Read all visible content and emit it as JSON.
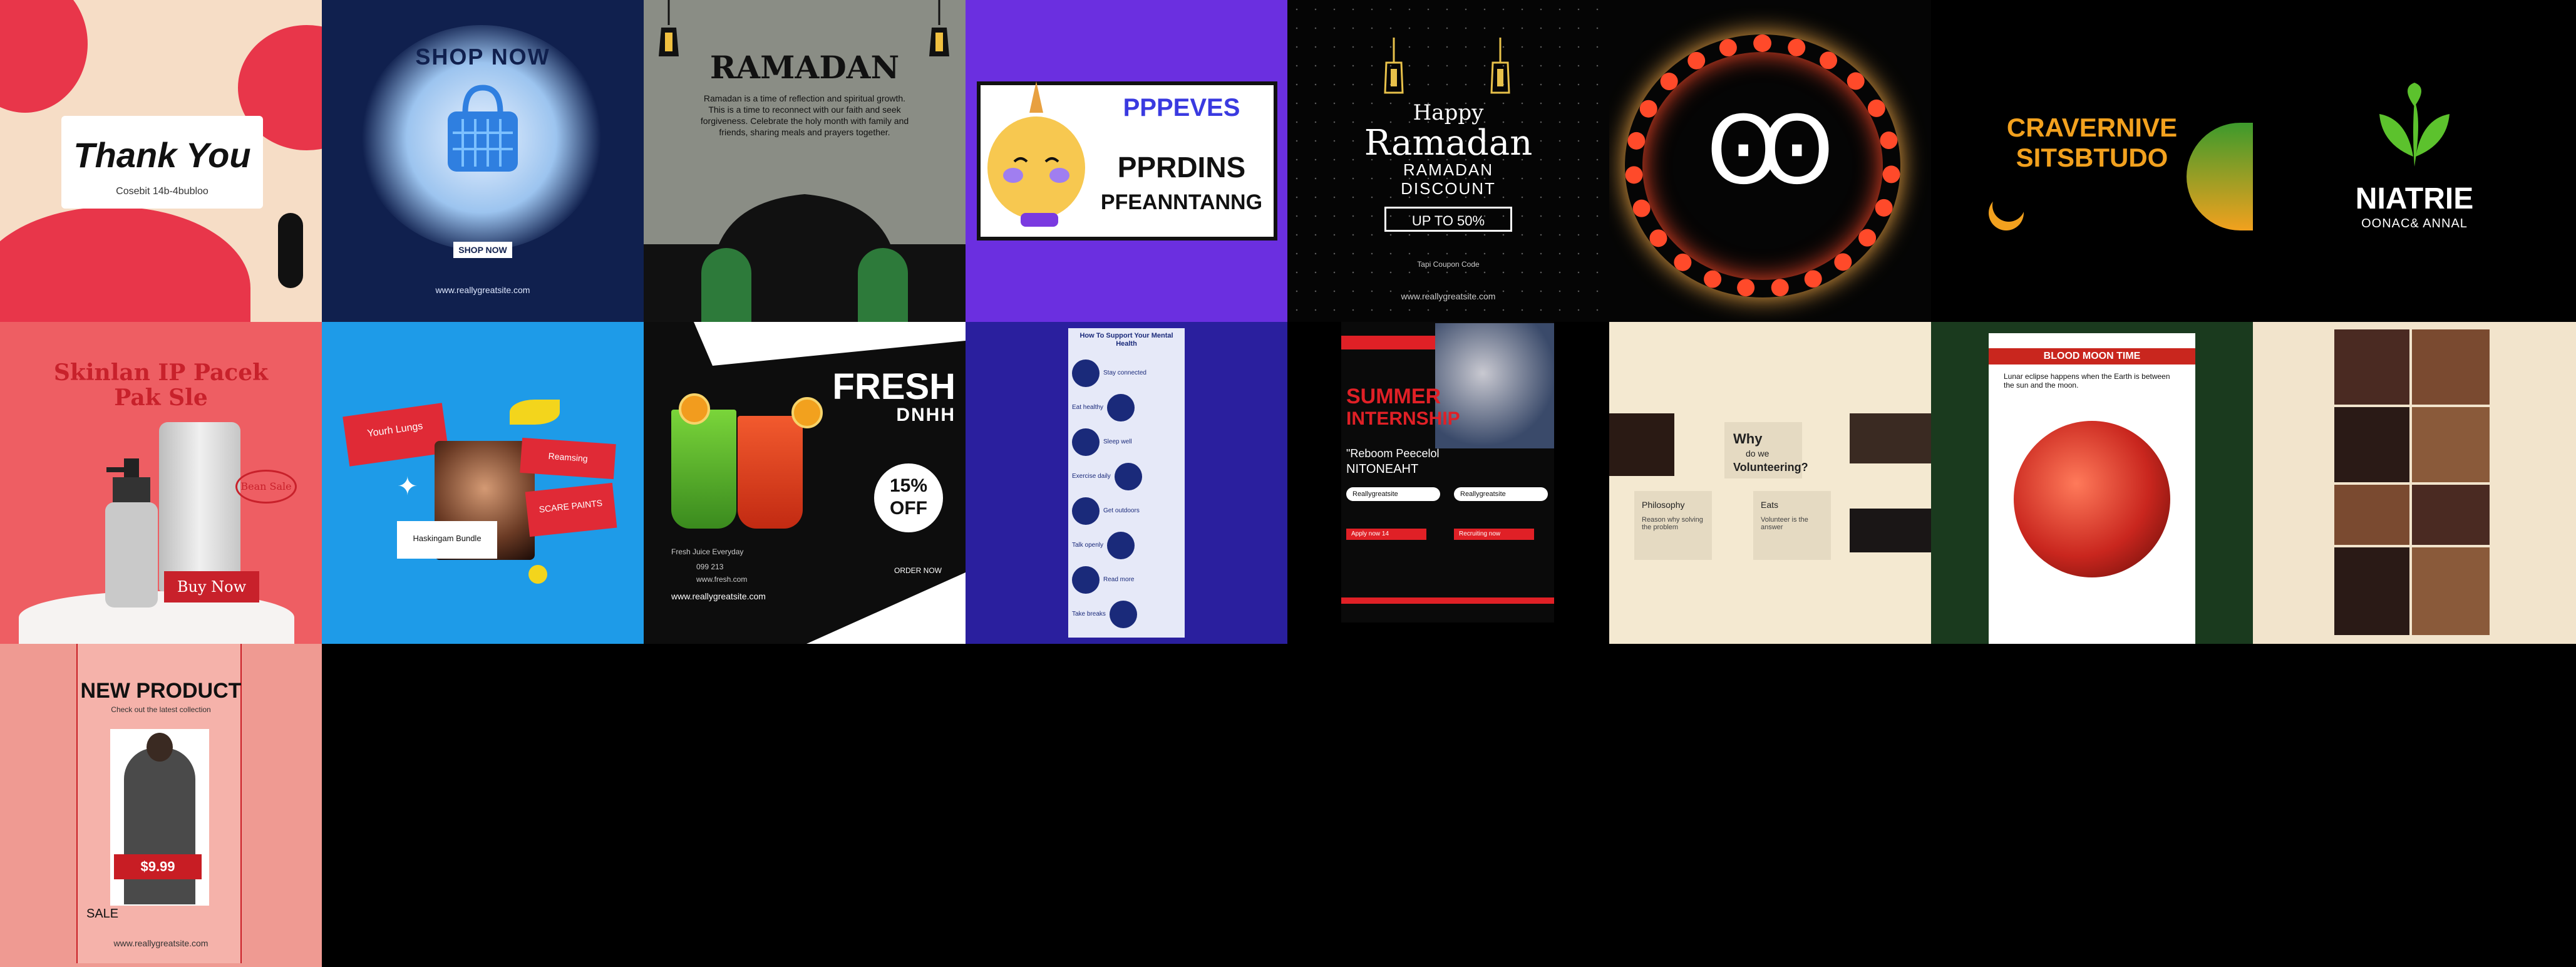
{
  "tiles": {
    "thank_you": {
      "title": "Thank You",
      "subtitle": "Cosebit 14b-4bubloo",
      "colors": {
        "bg": "#f6ddc6",
        "accent": "#e8364a",
        "dark": "#111111"
      }
    },
    "shop_now": {
      "title": "SHOP NOW",
      "button": "SHOP NOW",
      "footer": "www.reallygreatsite.com",
      "icon": "shopping-bag-icon",
      "colors": {
        "bg": "#10204e",
        "accent": "#2f7fe0"
      }
    },
    "ramadan_gray": {
      "title": "RAMADAN",
      "body": "Ramadan is a time of reflection and spiritual growth. This is a time to reconnect with our faith and seek forgiveness. Celebrate the holy month with family and friends, sharing meals and prayers together.",
      "colors": {
        "bg": "#8a8d85",
        "dark": "#151515",
        "green": "#2d7a3a"
      }
    },
    "promo_purple": {
      "line1": "PPPEVES",
      "line2": "PPRDINS",
      "line3": "PFEANNTANNG",
      "icon": "unicorn-face-icon",
      "colors": {
        "bg": "#6b2fe0",
        "panel": "#ffffff",
        "accent": "#3a3ae0"
      }
    },
    "happy_ramadan": {
      "line1": "Happy",
      "line2": "Ramadan",
      "line3": "RAMADAN",
      "line4": "DISCOUNT",
      "offer": "UP TO 50%",
      "small1": "Tapi Coupon Code",
      "small2": "www.reallygreatsite.com",
      "colors": {
        "bg": "#050505",
        "fg": "#ffffff",
        "gold": "#e8c14a"
      }
    },
    "lights_wreath": {
      "glyph": "Ꙭ",
      "colors": {
        "bg": "#050505",
        "light": "#ff4a2a",
        "glow": "#ffb24a"
      }
    },
    "crave_studio": {
      "line1": "CRAVERNIVE",
      "line2": "SITSBTUDO",
      "colors": {
        "bg": "#000000",
        "accent": "#f2a11e"
      }
    },
    "nature": {
      "title": "NIATRIE",
      "subtitle": "OONAC& ANNAL",
      "icon": "leaf-icon",
      "colors": {
        "bg": "#000000",
        "leaf": "#5cc22d"
      }
    },
    "skin_pack": {
      "title": "Skinlan IP Pacek",
      "title2": "Pak Sle",
      "badge": "Bean Sale",
      "button": "Buy Now",
      "colors": {
        "bg": "#ee5e63",
        "accent": "#c8212b"
      }
    },
    "blue_collage": {
      "tag1": "Yourh Lungs",
      "tag2": "Reamsing",
      "tag3": "SCARE PAINTS",
      "tag4": "Haskingam Bundle",
      "colors": {
        "bg": "#1e9be8",
        "tag": "#e02a36",
        "yellow": "#f3d51c"
      }
    },
    "fresh_drink": {
      "title": "FRESH",
      "subtitle": "DNHH",
      "discount": "15% OFF",
      "small1": "Fresh Juice Everyday",
      "small2": "099 213",
      "small3": "www.fresh.com",
      "small4": "ORDER NOW",
      "url": "www.reallygreatsite.com",
      "colors": {
        "bg": "#0d0d0d",
        "white": "#ffffff",
        "green": "#5bb22b",
        "red": "#e23e1f"
      }
    },
    "how_to": {
      "title": "How To Support Your Mental Health",
      "items": [
        "Stay connected",
        "Eat healthy",
        "Sleep well",
        "Exercise daily",
        "Get outdoors",
        "Talk openly",
        "Read more",
        "Take breaks"
      ],
      "colors": {
        "bg": "#2a1f9e",
        "panel": "#e6e9f8",
        "dark": "#1a2a7a"
      }
    },
    "summer_intern": {
      "line1": "SUMMER",
      "line2": "INTERNSHIP",
      "quote": "\"Reboom Peecelol",
      "quote2": "NITONEAHT",
      "b1": "Reallygreatsite",
      "b2": "Reallygreatsite",
      "b3": "Apply now 14",
      "b4": "Recruiting now",
      "colors": {
        "bg": "#0a0a0a",
        "red": "#e02026",
        "white": "#ffffff"
      }
    },
    "why_volunteer": {
      "title": "Why",
      "title2": "do we",
      "title3": "Volunteering?",
      "card1": "Philosophy",
      "card1b": "Reason why solving the problem",
      "card2": "Eats",
      "card2b": "Volunteer is the answer",
      "colors": {
        "bg": "#f4e9d1",
        "card": "#e5dac2",
        "dark": "#222222"
      }
    },
    "blood_moon": {
      "title": "BLOOD MOON TIME",
      "sub": "Lunar eclipse happens when the Earth is between the sun and the moon.",
      "colors": {
        "bg": "#1a3a1e",
        "paper": "#ffffff",
        "red": "#c9261e"
      }
    },
    "photo_grid": {
      "colors": {
        "bg": "#f2e4cc",
        "photo1": "#4a2a22",
        "photo2": "#7a4a30",
        "photo3": "#2a1a16",
        "photo4": "#8a5a3a"
      }
    },
    "new_product": {
      "title": "NEW PRODUCT",
      "subtitle": "Check out the latest collection",
      "tag": "SALE",
      "price": "$9.99",
      "url": "www.reallygreatsite.com",
      "colors": {
        "bg": "#ef9a92",
        "red": "#c81d24",
        "coat": "#4a4a4a"
      }
    }
  }
}
